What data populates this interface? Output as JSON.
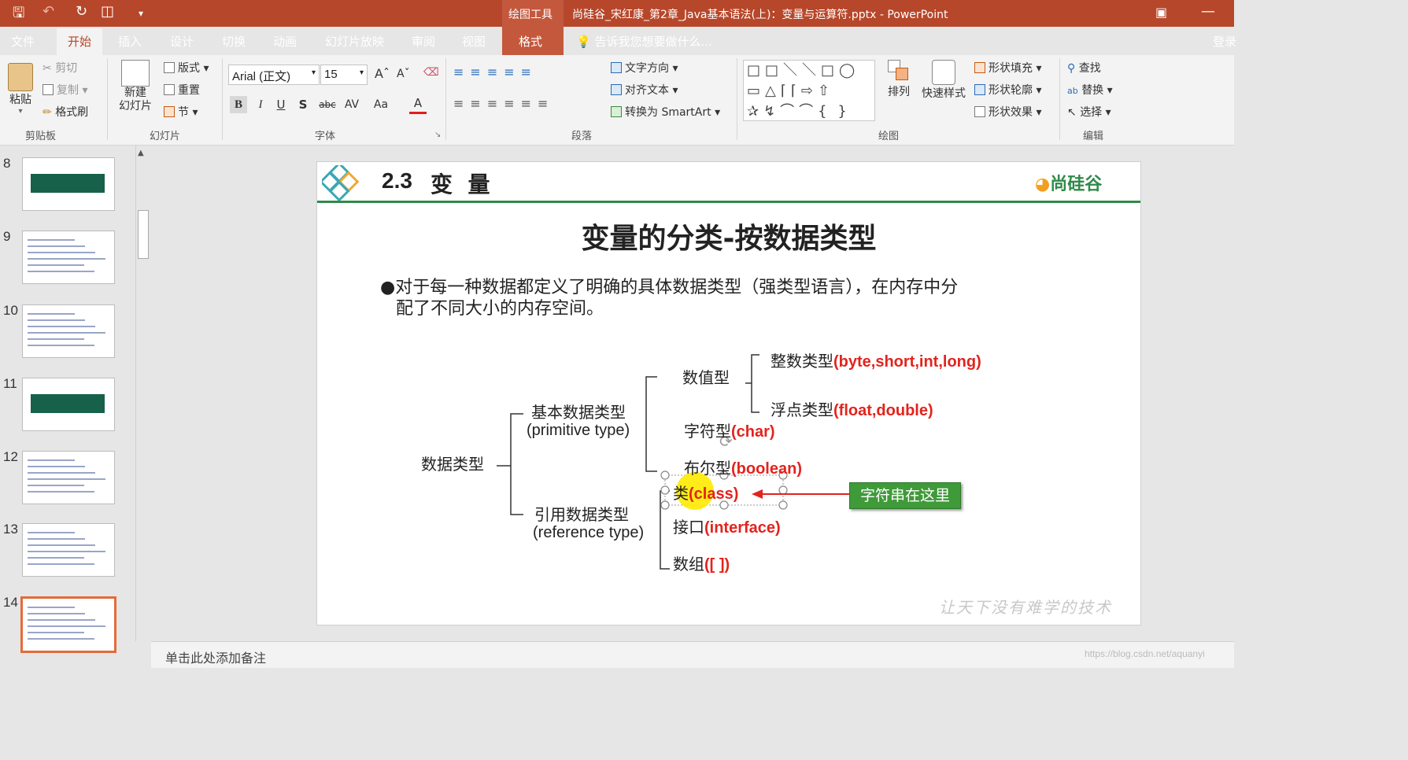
{
  "window": {
    "title": "尚硅谷_宋红康_第2章_Java基本语法(上)：变量与运算符.pptx - PowerPoint",
    "context_tab_group": "绘图工具",
    "signin": "登录",
    "colors": {
      "accent": "#b7472a",
      "green_button": "#3f9a3a",
      "red_text": "#e3231d"
    }
  },
  "tabs": [
    {
      "label": "文件"
    },
    {
      "label": "开始"
    },
    {
      "label": "插入"
    },
    {
      "label": "设计"
    },
    {
      "label": "切换"
    },
    {
      "label": "动画"
    },
    {
      "label": "幻灯片放映"
    },
    {
      "label": "审阅"
    },
    {
      "label": "视图"
    },
    {
      "label": "格式"
    }
  ],
  "tell_me": "告诉我您想要做什么...",
  "ribbon": {
    "clipboard": {
      "paste": "粘贴",
      "cut": "剪切",
      "copy": "复制",
      "format_painter": "格式刷",
      "group": "剪贴板"
    },
    "slides": {
      "new_slide": "新建\n幻灯片",
      "layout": "版式",
      "reset": "重置",
      "section": "节",
      "group": "幻灯片"
    },
    "font": {
      "name": "Arial (正文)",
      "size": "15",
      "group": "字体",
      "bold": "B",
      "italic": "I",
      "underline": "U",
      "shadow": "S",
      "strike": "abc",
      "spacing": "AV",
      "case": "Aa",
      "color": "A"
    },
    "paragraph": {
      "text_direction": "文字方向",
      "align_text": "对齐文本",
      "smartart": "转换为 SmartArt",
      "group": "段落"
    },
    "drawing": {
      "arrange": "排列",
      "quick_styles": "快速样式",
      "shape_fill": "形状填充",
      "shape_outline": "形状轮廓",
      "shape_effects": "形状效果",
      "group": "绘图"
    },
    "editing": {
      "find": "查找",
      "replace": "替换",
      "select": "选择",
      "group": "编辑"
    }
  },
  "thumbnails": [
    {
      "num": "8"
    },
    {
      "num": "9"
    },
    {
      "num": "10"
    },
    {
      "num": "11"
    },
    {
      "num": "12"
    },
    {
      "num": "13"
    },
    {
      "num": "14",
      "selected": true
    }
  ],
  "slide": {
    "section": "2.3",
    "section_title": "变  量",
    "logo": "尚硅谷",
    "title": "变量的分类-按数据类型",
    "bullet_line1": "对于每一种数据都定义了明确的具体数据类型（强类型语言），在内存中分",
    "bullet_line2": "配了不同大小的内存空间。",
    "root": "数据类型",
    "primitive_cn": "基本数据类型",
    "primitive_en": "(primitive type)",
    "numeric": "数值型",
    "integer_cn": "整数类型",
    "integer_en": "(byte,short,int,long)",
    "float_cn": "浮点类型",
    "float_en": "(float,double)",
    "char_cn": "字符型",
    "char_en": "(char)",
    "bool_cn": "布尔型",
    "bool_en": "(boolean)",
    "reference_cn": "引用数据类型",
    "reference_en": "(reference type)",
    "class_cn": "类",
    "class_en": "(class)",
    "interface_cn": "接口",
    "interface_en": "(interface)",
    "array_cn": "数组",
    "array_en": "([ ])",
    "callout": "字符串在这里",
    "slogan": "让天下没有难学的技术"
  },
  "notes_placeholder": "单击此处添加备注",
  "watermark": "https://blog.csdn.net/aquanyi"
}
